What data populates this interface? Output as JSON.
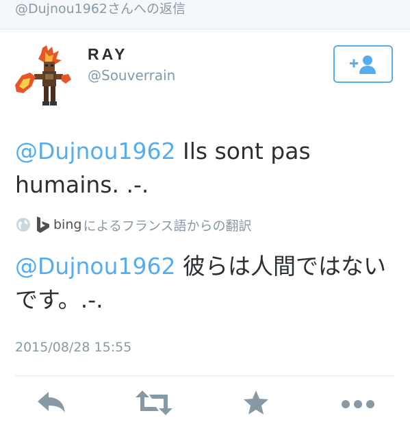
{
  "reply_header": "@Dujnou1962さんへの返信",
  "user": {
    "display_name": "RAY",
    "screen_name": "@Souverrain"
  },
  "tweet": {
    "mention": "@Dujnou1962",
    "text": " Ils sont pas humains. .-."
  },
  "translation": {
    "engine": "bing",
    "label": "によるフランス語からの翻訳",
    "mention": "@Dujnou1962",
    "text": " 彼らは人間ではないです。.-."
  },
  "timestamp": "2015/08/28 15:55",
  "colors": {
    "accent": "#55acee",
    "icon_gray": "#8899a6",
    "text": "#292f33"
  },
  "icons": [
    "follow-icon",
    "globe-icon",
    "bing-logo-icon",
    "reply-icon",
    "retweet-icon",
    "favorite-icon",
    "more-icon"
  ]
}
